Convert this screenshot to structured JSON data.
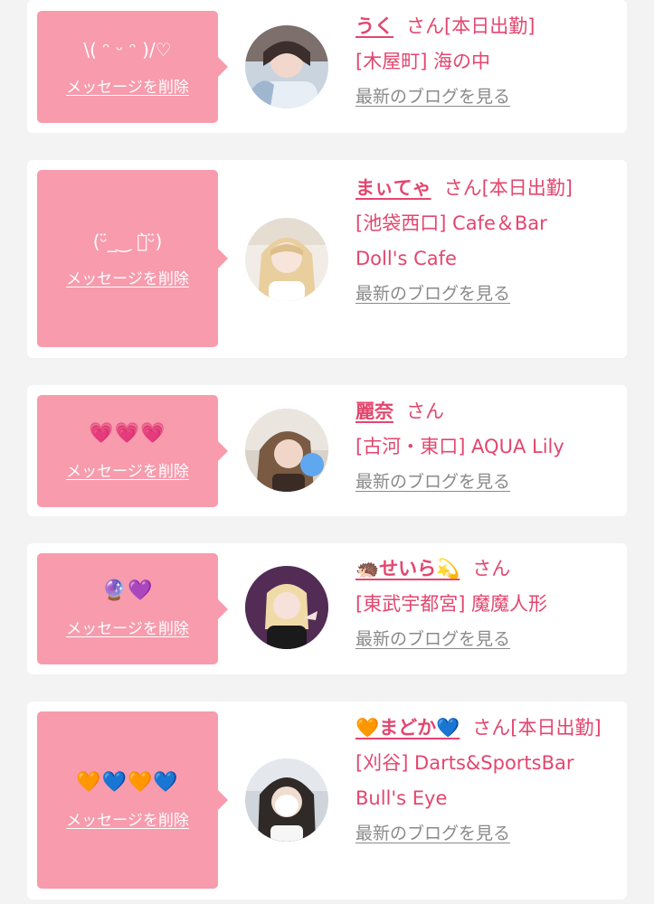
{
  "delete_label": "メッセージを削除",
  "blog_label": "最新のブログを見る",
  "honorific": "さん",
  "colors": {
    "page_bg": "#f3f3f3",
    "card_bg": "#ffffff",
    "bubble_bg": "#f79bad",
    "accent_text": "#e3466e",
    "link_gray": "#8a8a8a"
  },
  "entries": [
    {
      "message": "\\( ᵔ ᵕ ᵔ )/♡",
      "name": "うく",
      "status": "[本日出勤]",
      "store_line1": "[木屋町] 海の中",
      "store_line2": "",
      "avatar_icon": "cast-photo-avatar"
    },
    {
      "message": "(ᵕ̈_‿ ก̀ᵕ̈)",
      "name": "まぃてゃ",
      "status": "[本日出勤]",
      "store_line1": "[池袋西口] Cafe＆Bar",
      "store_line2": "Doll's Cafe",
      "avatar_icon": "cast-photo-avatar"
    },
    {
      "message": "💗💗💗",
      "name": "麗奈",
      "status": "",
      "store_line1": "[古河・東口] AQUA Lily",
      "store_line2": "",
      "avatar_icon": "cast-photo-avatar"
    },
    {
      "message": "🔮💜",
      "name": "🦔せいら💫",
      "status": "",
      "store_line1": "[東武宇都宮] 魔魔人形",
      "store_line2": "",
      "avatar_icon": "cast-photo-avatar"
    },
    {
      "message": "🧡💙🧡💙",
      "name": "🧡まどか💙",
      "status": "[本日出勤]",
      "store_line1": "[刈谷] Darts&SportsBar",
      "store_line2": "Bull's Eye",
      "avatar_icon": "cast-photo-avatar"
    }
  ]
}
